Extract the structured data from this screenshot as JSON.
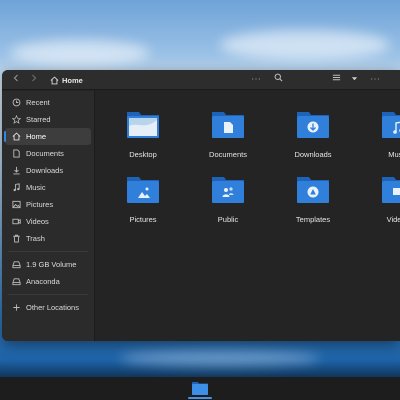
{
  "window": {
    "title": "Home"
  },
  "header": {
    "breadcrumb_icon": "home-icon",
    "breadcrumb_label": "Home",
    "overflow_glyph": "⋯",
    "search_icon": "search-icon",
    "view_icon": "list-view-icon",
    "sort_icon": "chevron-down-icon",
    "menu_glyph": "⋯"
  },
  "sidebar": {
    "items": [
      {
        "label": "Recent",
        "icon": "clock-icon"
      },
      {
        "label": "Starred",
        "icon": "star-icon"
      },
      {
        "label": "Home",
        "icon": "home-icon",
        "active": true
      },
      {
        "label": "Documents",
        "icon": "document-icon"
      },
      {
        "label": "Downloads",
        "icon": "download-icon"
      },
      {
        "label": "Music",
        "icon": "music-icon"
      },
      {
        "label": "Pictures",
        "icon": "picture-icon"
      },
      {
        "label": "Videos",
        "icon": "video-icon"
      },
      {
        "label": "Trash",
        "icon": "trash-icon"
      }
    ],
    "volumes": [
      {
        "label": "1.9 GB Volume",
        "icon": "drive-icon"
      },
      {
        "label": "Anaconda",
        "icon": "drive-icon"
      }
    ],
    "other": {
      "label": "Other Locations",
      "icon": "plus-icon"
    }
  },
  "files": [
    {
      "label": "Desktop",
      "icon": "desktop-folder-icon"
    },
    {
      "label": "Documents",
      "icon": "documents-folder-icon"
    },
    {
      "label": "Downloads",
      "icon": "downloads-folder-icon"
    },
    {
      "label": "Music",
      "icon": "music-folder-icon"
    },
    {
      "label": "Pictures",
      "icon": "pictures-folder-icon"
    },
    {
      "label": "Public",
      "icon": "public-folder-icon"
    },
    {
      "label": "Templates",
      "icon": "templates-folder-icon"
    },
    {
      "label": "Videos",
      "icon": "videos-folder-icon"
    }
  ],
  "colors": {
    "accent": "#3584e4",
    "folder": "#2f7fdb",
    "folder_dark": "#1e63b8",
    "window_bg": "#242424",
    "sidebar_bg": "#2b2b2b"
  },
  "taskbar": {
    "app_icon": "files-folder-icon"
  }
}
